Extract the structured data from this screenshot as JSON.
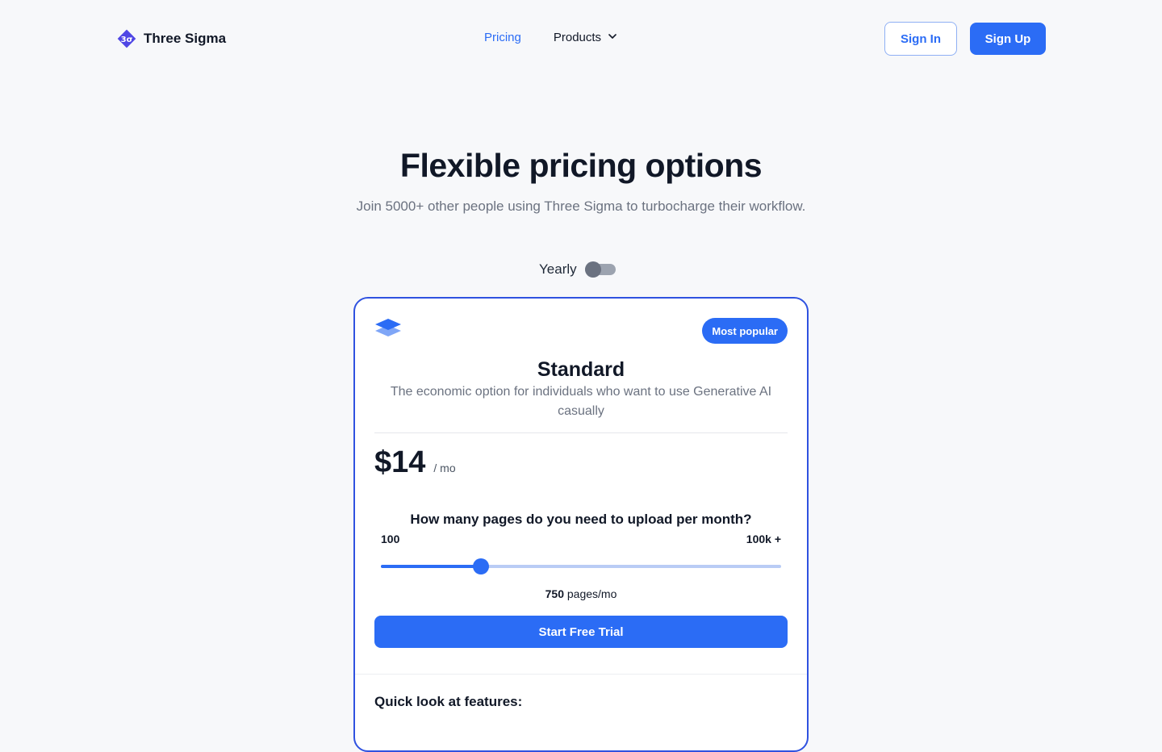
{
  "nav": {
    "brand": "Three Sigma",
    "brand_mark_text": "3σ",
    "links": {
      "pricing": "Pricing",
      "products": "Products"
    },
    "sign_in": "Sign In",
    "sign_up": "Sign Up"
  },
  "hero": {
    "title": "Flexible pricing options",
    "subtitle": "Join 5000+ other people using Three Sigma to turbocharge their workflow."
  },
  "billing": {
    "label": "Yearly",
    "yearly_enabled": false
  },
  "plan": {
    "badge": "Most popular",
    "name": "Standard",
    "description": "The economic option for individuals who want to use Generative AI casually",
    "price": "$14",
    "price_unit": "/ mo",
    "question": "How many pages do you need to upload per month?",
    "range_min": "100",
    "range_max": "100k +",
    "slider_fraction": 0.25,
    "pages_value": "750",
    "pages_unit": "pages/mo",
    "cta": "Start Free Trial",
    "features_title": "Quick look at features:"
  },
  "colors": {
    "accent": "#2b6cf5",
    "card_border": "#2f52e0",
    "brand_mark": "#4f46e5"
  }
}
